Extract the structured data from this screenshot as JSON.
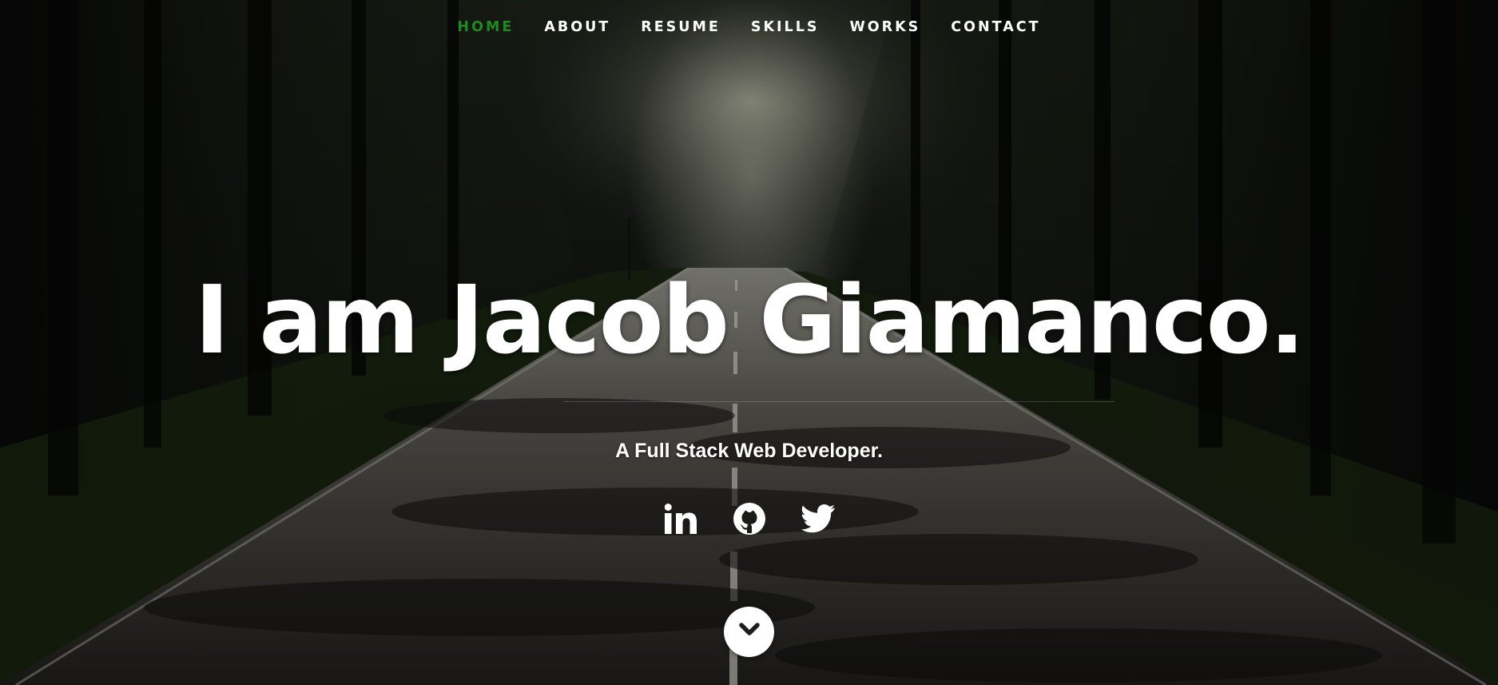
{
  "nav": {
    "items": [
      {
        "label": "HOME",
        "active": true
      },
      {
        "label": "ABOUT",
        "active": false
      },
      {
        "label": "RESUME",
        "active": false
      },
      {
        "label": "SKILLS",
        "active": false
      },
      {
        "label": "WORKS",
        "active": false
      },
      {
        "label": "CONTACT",
        "active": false
      }
    ],
    "active_color": "#1f8a1f"
  },
  "hero": {
    "headline": "I am Jacob Giamanco.",
    "subtitle": "A Full Stack Web Developer."
  },
  "social": [
    {
      "icon": "linkedin-icon"
    },
    {
      "icon": "github-icon"
    },
    {
      "icon": "twitter-icon"
    }
  ],
  "scroll_button": {
    "icon": "chevron-down-icon"
  },
  "background": {
    "icon": "forest-road-photo"
  }
}
